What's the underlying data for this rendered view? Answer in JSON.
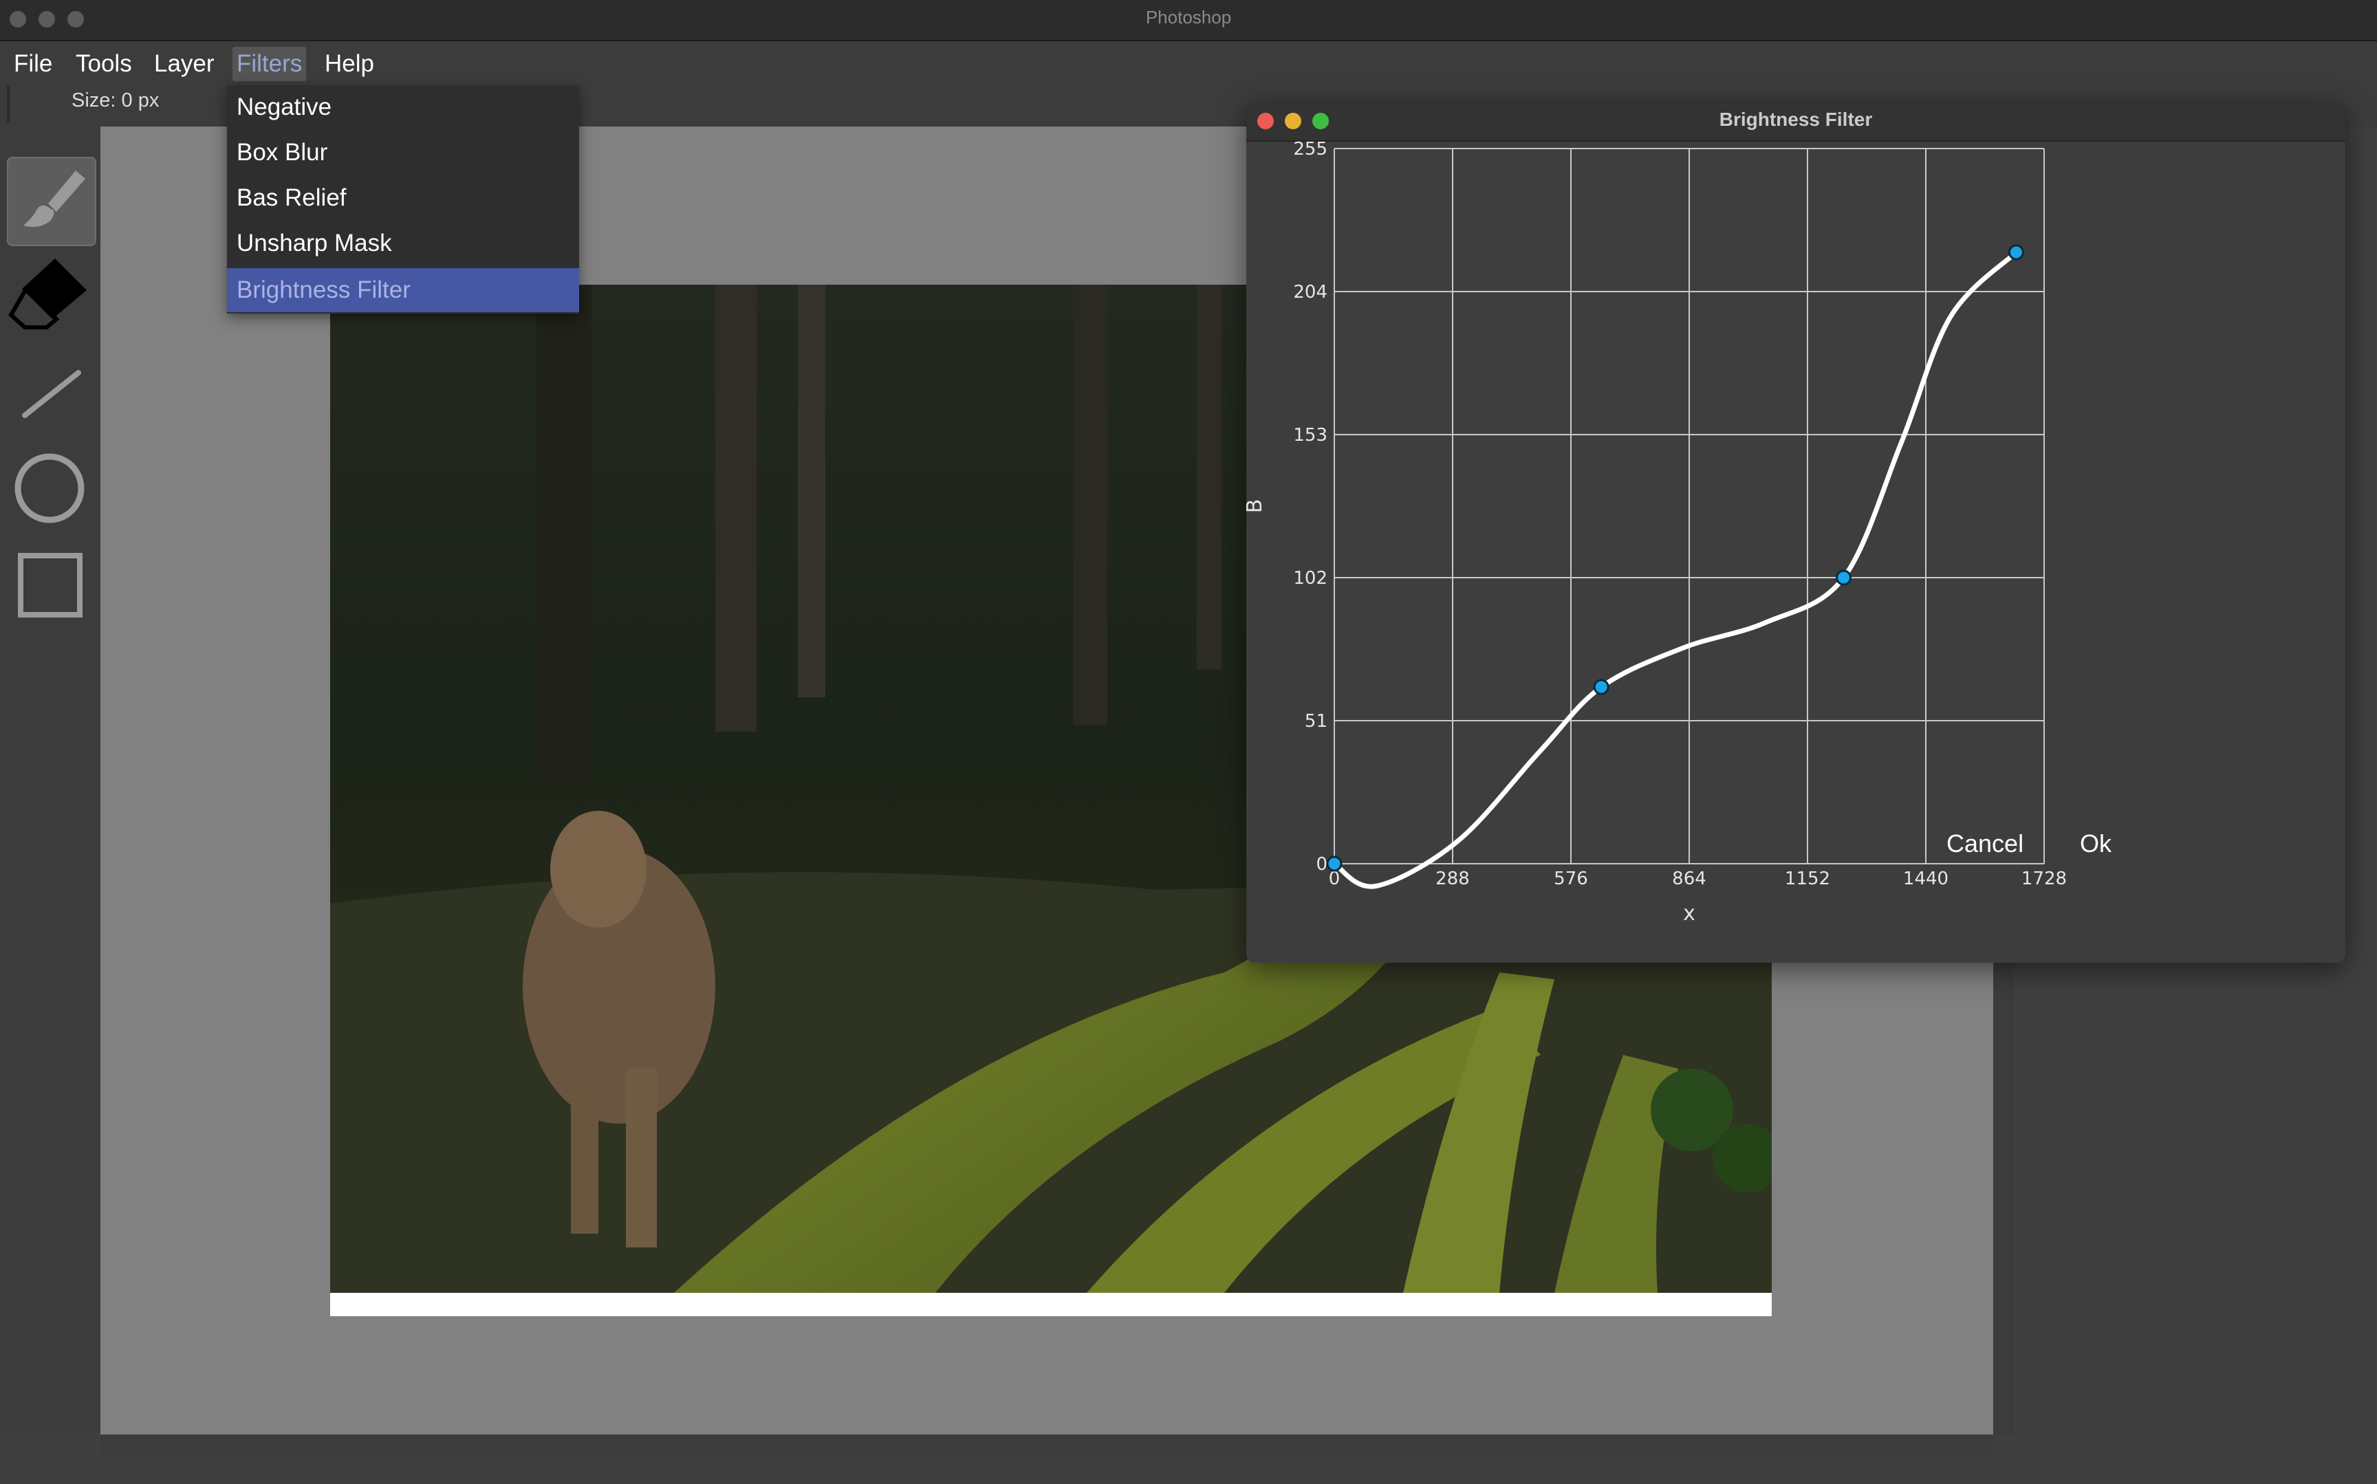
{
  "window": {
    "title": "Photoshop"
  },
  "menu": {
    "items": [
      {
        "label": "File"
      },
      {
        "label": "Tools"
      },
      {
        "label": "Layer"
      },
      {
        "label": "Filters"
      },
      {
        "label": "Help"
      }
    ],
    "active": "Filters"
  },
  "options_bar": {
    "size_label": "Size: 0 px"
  },
  "tools": [
    {
      "icon": "brush-icon",
      "selected": true
    },
    {
      "icon": "eraser-icon",
      "selected": false
    },
    {
      "icon": "line-icon",
      "selected": false
    },
    {
      "icon": "circle-icon",
      "selected": false
    },
    {
      "icon": "rectangle-icon",
      "selected": false
    }
  ],
  "filters_menu": {
    "items": [
      {
        "label": "Negative"
      },
      {
        "label": "Box Blur"
      },
      {
        "label": "Bas Relief"
      },
      {
        "label": "Unsharp Mask"
      },
      {
        "label": "Brightness Filter"
      }
    ],
    "highlighted": "Brightness Filter"
  },
  "dialog": {
    "title": "Brightness Filter",
    "cancel_label": "Cancel",
    "ok_label": "Ok"
  },
  "chart_data": {
    "type": "line",
    "xlabel": "x",
    "ylabel": "B",
    "xlim": [
      0,
      1728
    ],
    "ylim": [
      0,
      255
    ],
    "x_ticks": [
      "0",
      "288",
      "576",
      "864",
      "1152",
      "1440",
      "1728"
    ],
    "y_ticks": [
      "0",
      "51",
      "102",
      "153",
      "204",
      "255"
    ],
    "grid": true,
    "control_points": [
      {
        "x": 0,
        "y": 0
      },
      {
        "x": 650,
        "y": 63
      },
      {
        "x": 1240,
        "y": 102
      },
      {
        "x": 1660,
        "y": 218
      }
    ],
    "curve": [
      {
        "x": 0,
        "y": 0
      },
      {
        "x": 100,
        "y": -8
      },
      {
        "x": 300,
        "y": 8
      },
      {
        "x": 500,
        "y": 40
      },
      {
        "x": 650,
        "y": 63
      },
      {
        "x": 850,
        "y": 77
      },
      {
        "x": 1050,
        "y": 86
      },
      {
        "x": 1240,
        "y": 102
      },
      {
        "x": 1380,
        "y": 150
      },
      {
        "x": 1500,
        "y": 195
      },
      {
        "x": 1660,
        "y": 218
      }
    ],
    "colors": {
      "curve": "#ffffff",
      "point": "#1aa3e8",
      "grid": "#c9c9c9",
      "plot_bg": "#3e3e3e"
    }
  }
}
